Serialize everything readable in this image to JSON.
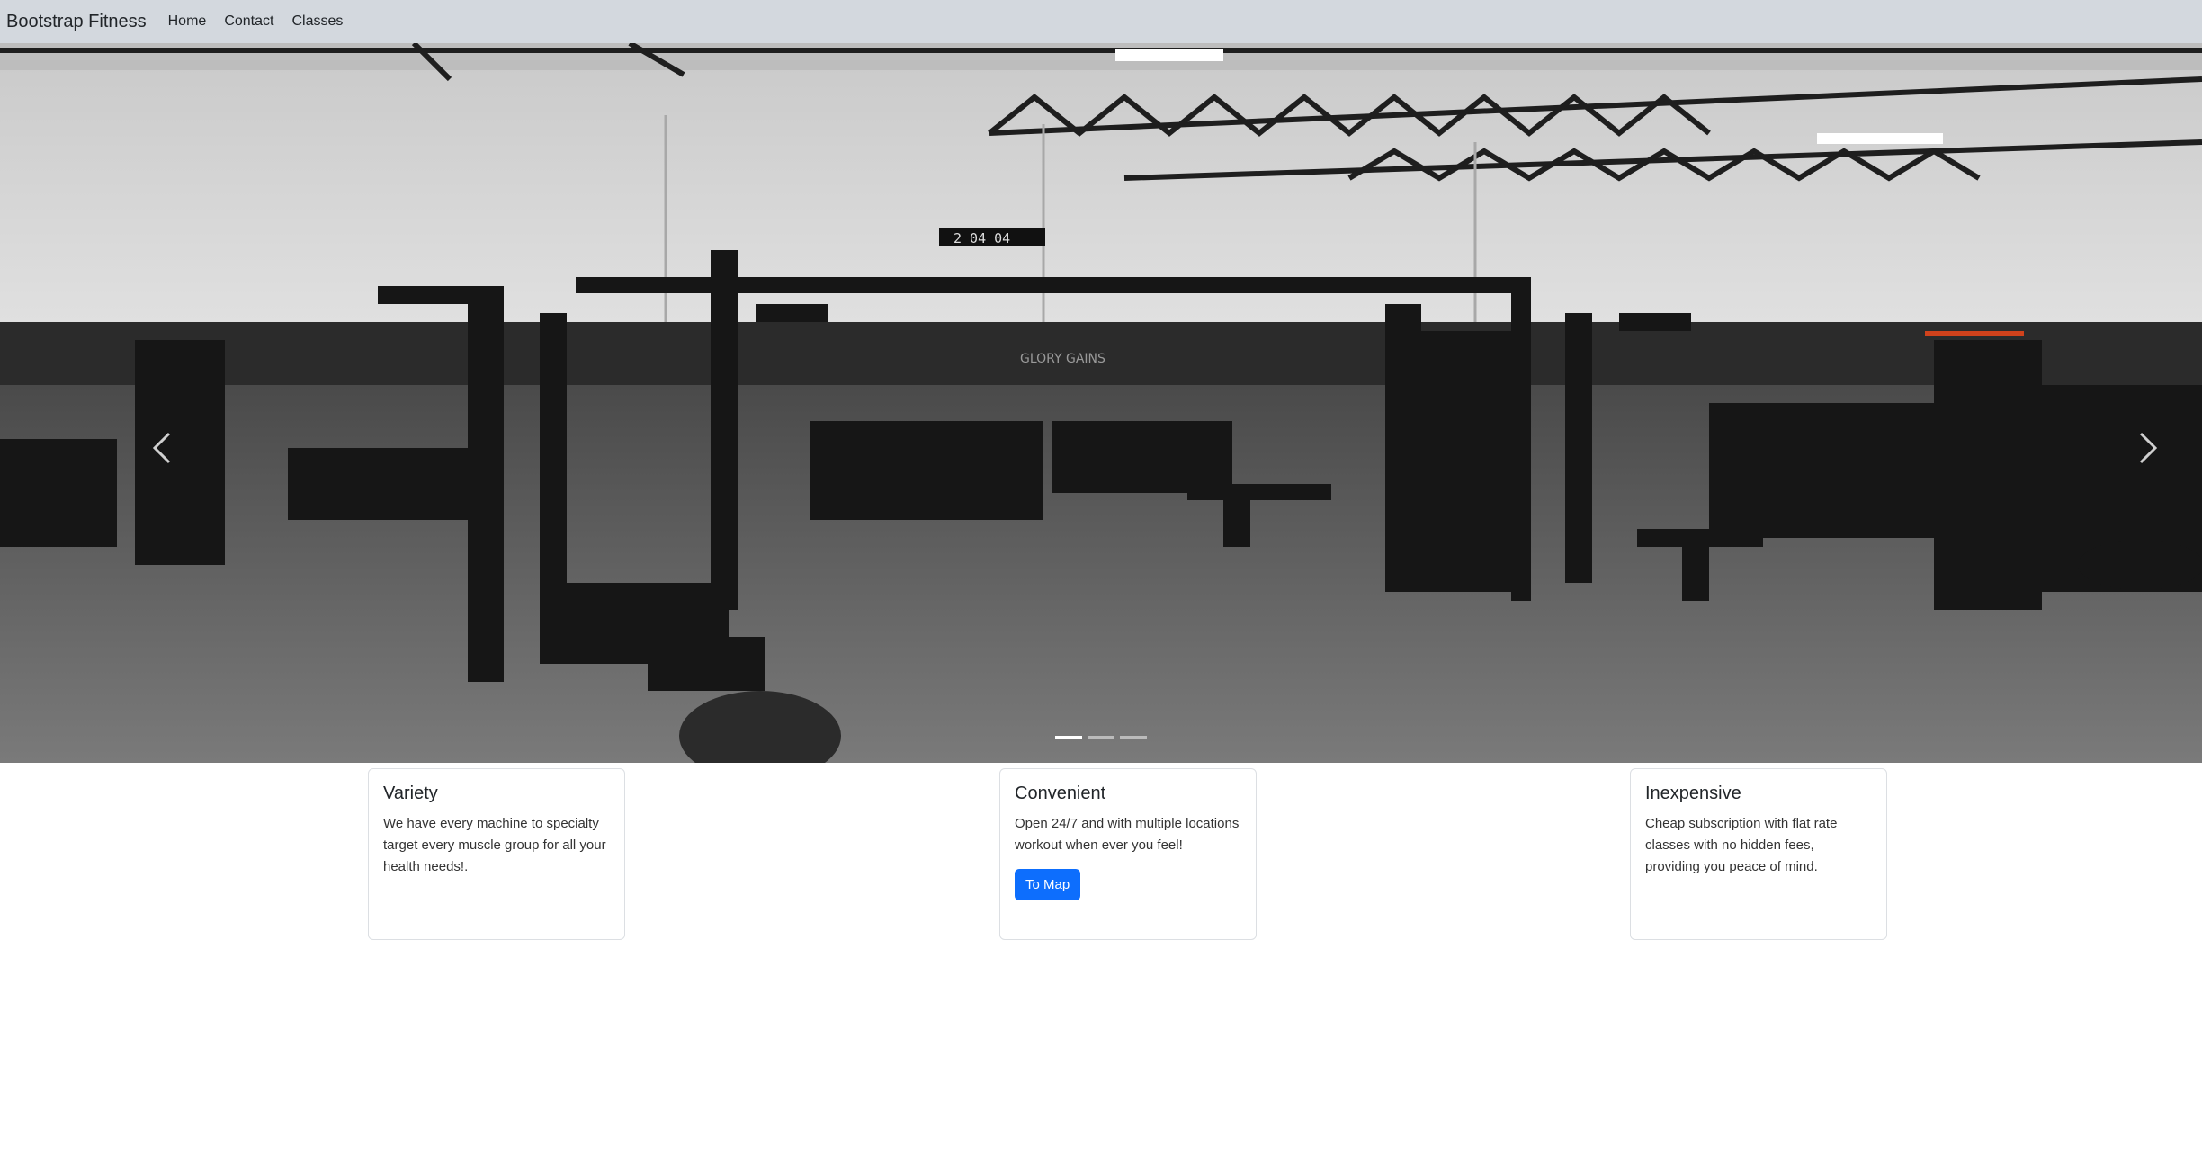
{
  "navbar": {
    "brand": "Bootstrap Fitness",
    "links": [
      "Home",
      "Contact",
      "Classes"
    ]
  },
  "carousel": {
    "image_alt": "Gym floor with weight machines",
    "slides": 3,
    "active_slide": 1,
    "prev_icon": "chevron-left-icon",
    "next_icon": "chevron-right-icon",
    "display_clock": "2 04 04",
    "wall_sign": "GLORY GAINS"
  },
  "cards": [
    {
      "title": "Variety",
      "text": "We have every machine to specialty target every muscle group for all your health needs!."
    },
    {
      "title": "Convenient",
      "text": "Open 24/7 and with multiple locations workout when ever you feel!",
      "button": "To Map"
    },
    {
      "title": "Inexpensive",
      "text": "Cheap subscription with flat rate classes with no hidden fees, providing you peace of mind."
    }
  ],
  "colors": {
    "navbar_bg": "#d3d8de",
    "primary": "#0d6efd"
  }
}
